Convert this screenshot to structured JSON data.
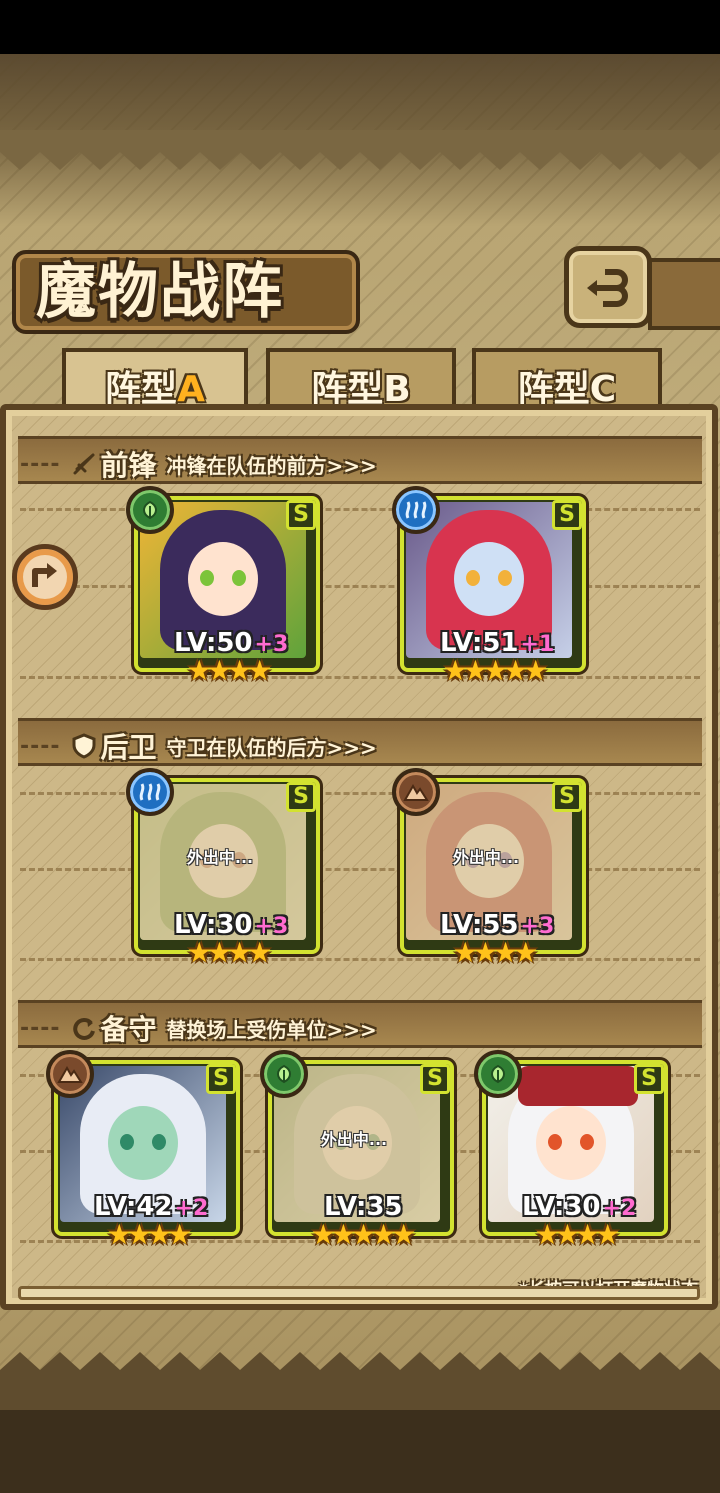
{
  "screen": {
    "title": "魔物战阵"
  },
  "tabs": [
    {
      "prefix": "阵型",
      "letter": "A",
      "active": true
    },
    {
      "prefix": "阵型",
      "letter": "B",
      "active": false
    },
    {
      "prefix": "阵型",
      "letter": "C",
      "active": false
    }
  ],
  "sections": {
    "front": {
      "dashes": "----",
      "name": "前锋",
      "desc": "冲锋在队伍的前方>>>"
    },
    "back": {
      "dashes": "----",
      "name": "后卫",
      "desc": "守卫在队伍的后方>>>"
    },
    "reserve": {
      "dashes": "----",
      "name": "备守",
      "desc": "替换场上受伤单位>>>"
    }
  },
  "cards": {
    "front_1": {
      "rank": "S",
      "element": "grass",
      "level": "LV:50",
      "plus": "+3",
      "stars": "★★★★",
      "away": ""
    },
    "front_2": {
      "rank": "S",
      "element": "water",
      "level": "LV:51",
      "plus": "+1",
      "stars": "★★★★★",
      "away": ""
    },
    "back_1": {
      "rank": "S",
      "element": "water",
      "level": "LV:30",
      "plus": "+3",
      "stars": "★★★★",
      "away": "外出中..."
    },
    "back_2": {
      "rank": "S",
      "element": "earth",
      "level": "LV:55",
      "plus": "+3",
      "stars": "★★★★",
      "away": "外出中..."
    },
    "reserve_1": {
      "rank": "S",
      "element": "earth",
      "level": "LV:42",
      "plus": "+2",
      "stars": "★★★★",
      "away": ""
    },
    "reserve_2": {
      "rank": "S",
      "element": "grass",
      "level": "LV:35",
      "plus": "",
      "stars": "★★★★★",
      "away": "外出中..."
    },
    "reserve_3": {
      "rank": "S",
      "element": "grass",
      "level": "LV:30",
      "plus": "+2",
      "stars": "★★★★",
      "away": ""
    }
  },
  "footer": {
    "hint": "*长按可以打开魔物状态"
  },
  "icons": {
    "back": "return-arrow-icon",
    "side": "swap-arrow-icon"
  },
  "colors": {
    "card_border": "#d3e230",
    "plus_level": "#ff6bd0",
    "star": "#ffc21a",
    "tab_letter": "#ffb11f"
  }
}
